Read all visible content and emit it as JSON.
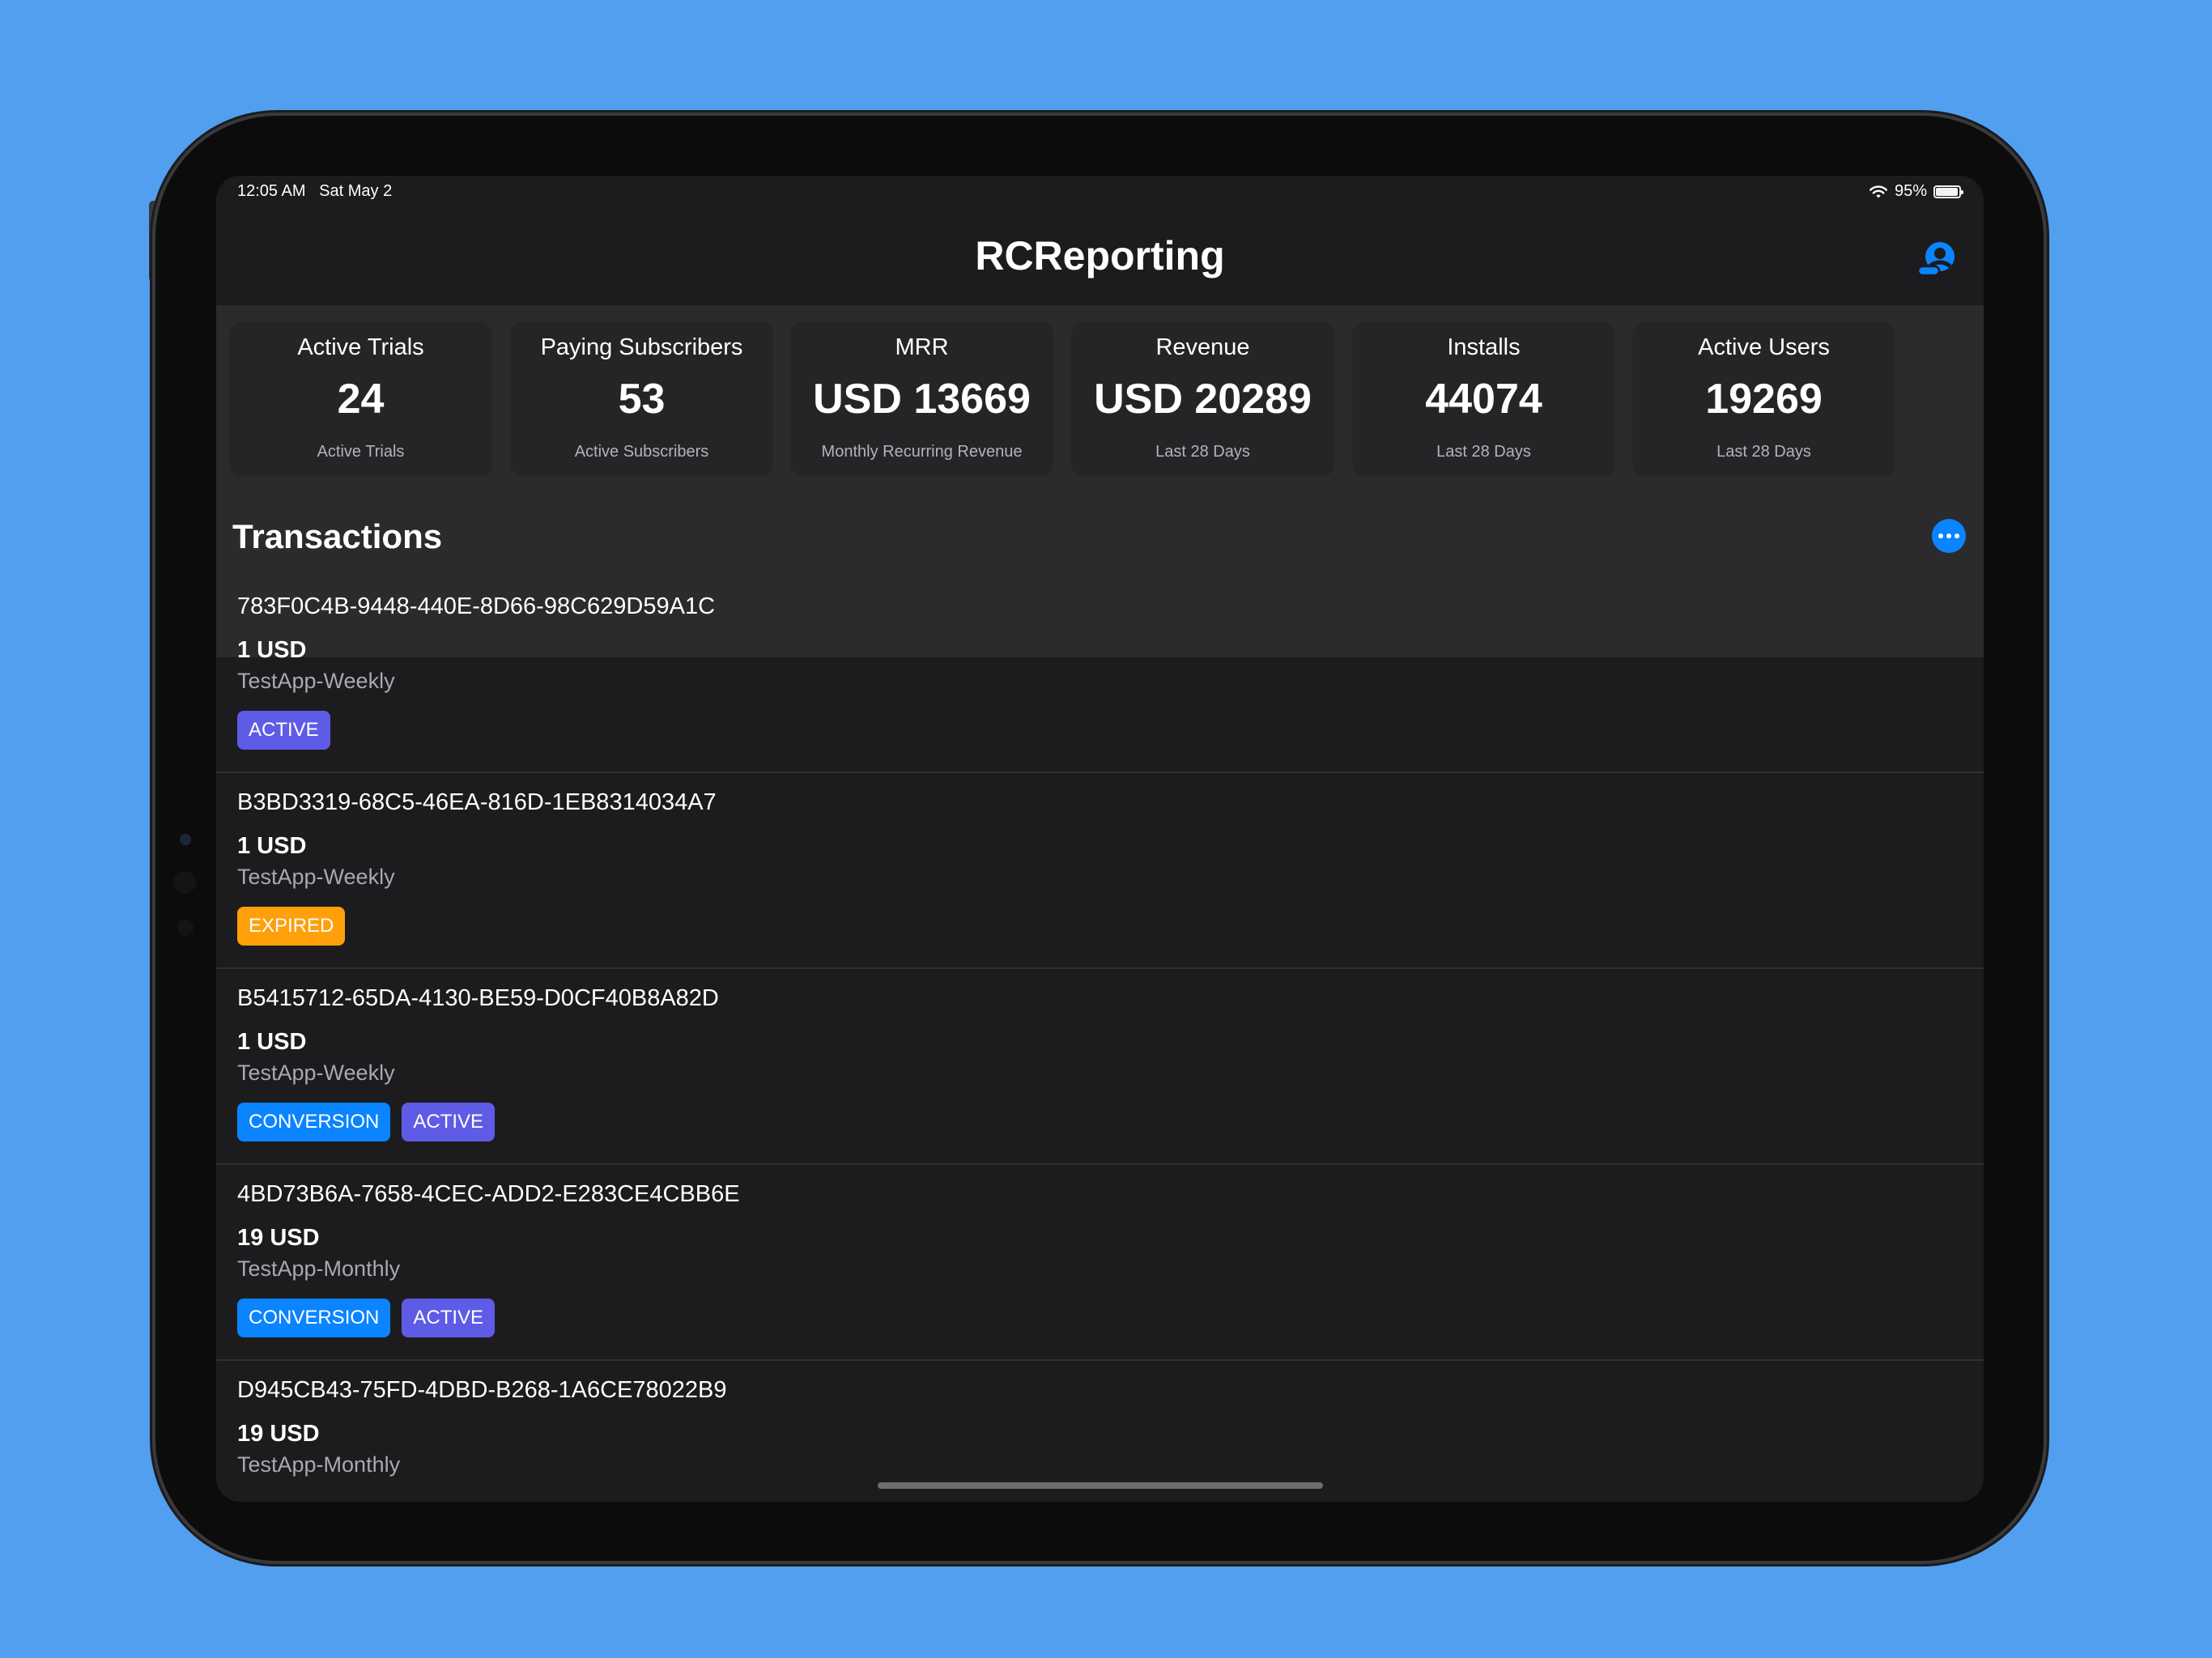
{
  "status_bar": {
    "time_date": "12:05 AM   Sat May 2",
    "battery_percent": "95%",
    "battery_level": 0.95
  },
  "nav": {
    "title": "RCReporting",
    "profile_icon": "person-circle-icon"
  },
  "stats": [
    {
      "title": "Active Trials",
      "value": "24",
      "subtitle": "Active Trials"
    },
    {
      "title": "Paying Subscribers",
      "value": "53",
      "subtitle": "Active Subscribers"
    },
    {
      "title": "MRR",
      "value": "USD 13669",
      "subtitle": "Monthly Recurring Revenue"
    },
    {
      "title": "Revenue",
      "value": "USD 20289",
      "subtitle": "Last 28 Days"
    },
    {
      "title": "Installs",
      "value": "44074",
      "subtitle": "Last 28 Days"
    },
    {
      "title": "Active Users",
      "value": "19269",
      "subtitle": "Last 28 Days"
    }
  ],
  "transactions": {
    "title": "Transactions",
    "more_icon": "ellipsis-circle-icon",
    "items": [
      {
        "id": "783F0C4B-9448-440E-8D66-98C629D59A1C",
        "price": "1 USD",
        "product": "TestApp-Weekly",
        "badges": [
          {
            "label": "ACTIVE",
            "kind": "active"
          }
        ]
      },
      {
        "id": "B3BD3319-68C5-46EA-816D-1EB8314034A7",
        "price": "1 USD",
        "product": "TestApp-Weekly",
        "badges": [
          {
            "label": "EXPIRED",
            "kind": "expired"
          }
        ]
      },
      {
        "id": "B5415712-65DA-4130-BE59-D0CF40B8A82D",
        "price": "1 USD",
        "product": "TestApp-Weekly",
        "badges": [
          {
            "label": "CONVERSION",
            "kind": "conversion"
          },
          {
            "label": "ACTIVE",
            "kind": "active"
          }
        ]
      },
      {
        "id": "4BD73B6A-7658-4CEC-ADD2-E283CE4CBB6E",
        "price": "19 USD",
        "product": "TestApp-Monthly",
        "badges": [
          {
            "label": "CONVERSION",
            "kind": "conversion"
          },
          {
            "label": "ACTIVE",
            "kind": "active"
          }
        ]
      },
      {
        "id": "D945CB43-75FD-4DBD-B268-1A6CE78022B9",
        "price": "19 USD",
        "product": "TestApp-Monthly",
        "badges": []
      }
    ]
  },
  "colors": {
    "background": "#529ff0",
    "accent_blue": "#0a84ff",
    "badge_active": "#5e5ce6",
    "badge_expired": "#ff9f0a",
    "screen_bg": "#1c1c1e"
  }
}
